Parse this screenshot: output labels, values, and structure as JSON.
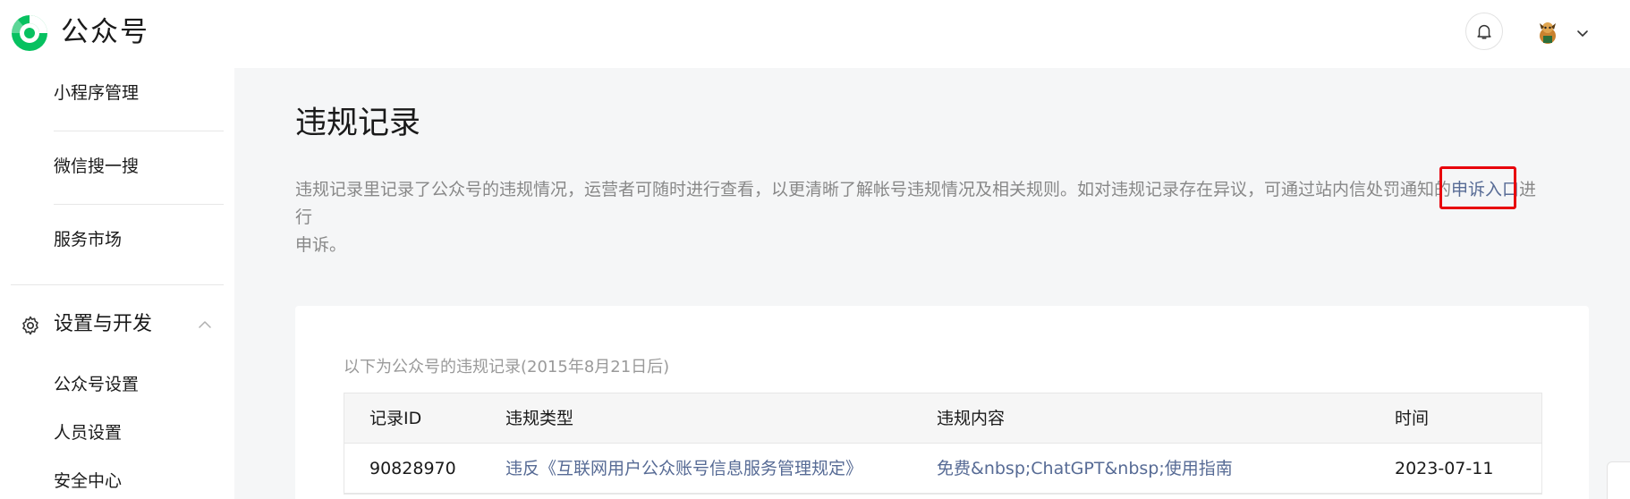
{
  "header": {
    "brand": "公众号",
    "icons": {
      "logo": "wechat-official-account-logo",
      "bell": "bell-icon",
      "avatar": "user-avatar",
      "chevron": "chevron-down-icon"
    }
  },
  "sidebar": {
    "items_top": [
      "小程序管理",
      "微信搜一搜",
      "服务市场"
    ],
    "section": {
      "label": "设置与开发",
      "icon": "gear-icon",
      "expanded": true
    },
    "section_items": [
      "公众号设置",
      "人员设置",
      "安全中心"
    ]
  },
  "main": {
    "title": "违规记录",
    "desc_line1_before": "违规记录里记录了公众号的违规情况，运营者可随时进行查看，以更清晰了解帐号违规情况及相关规则。如对违规记录存在异议，可通过站内信处罚通知的",
    "desc_link": "申诉入口",
    "desc_line1_after": "进行",
    "desc_line2": "申诉。",
    "card": {
      "caption": "以下为公众号的违规记录(2015年8月21日后)",
      "columns": [
        "记录ID",
        "违规类型",
        "违规内容",
        "时间"
      ],
      "rows": [
        [
          "90828970",
          "违反《互联网用户公众账号信息服务管理规定》",
          "免费&nbsp;ChatGPT&nbsp;使用指南",
          "2023-07-11"
        ]
      ]
    }
  },
  "colors": {
    "link": "#576b95",
    "highlight": "#e8000b",
    "brand_green": "#07c160"
  }
}
